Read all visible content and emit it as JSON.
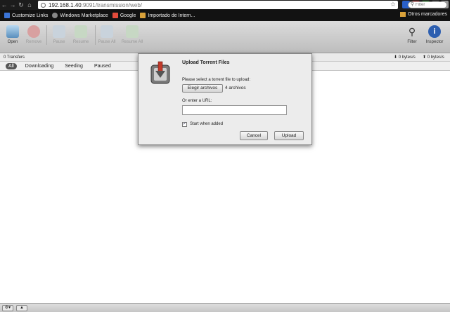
{
  "browser": {
    "url_host": "192.168.1.40",
    "url_rest": ":9091/transmission/web/",
    "bookmarks": [
      {
        "label": "Customize Links",
        "icon": "m-logo-icon"
      },
      {
        "label": "Windows Marketplace",
        "icon": "globe-icon"
      },
      {
        "label": "Google",
        "icon": "google-icon"
      },
      {
        "label": "Importado de Intern...",
        "icon": "folder-icon"
      }
    ],
    "other_bookmarks": "Otros marcadores"
  },
  "toolbar": {
    "open": "Open",
    "remove": "Remove",
    "pause": "Pause",
    "resume": "Resume",
    "pause_all": "Pause All",
    "resume_all": "Resume All",
    "filter": "Filter",
    "inspector": "Inspector"
  },
  "status": {
    "transfers": "0 Transfers",
    "down_speed": "0 bytes/s",
    "up_speed": "0 bytes/s"
  },
  "filters": {
    "tabs": [
      "All",
      "Downloading",
      "Seeding",
      "Paused"
    ],
    "active": "All",
    "search_placeholder": "Filter"
  },
  "dialog": {
    "title": "Upload Torrent Files",
    "select_label": "Please select a torrent file to upload:",
    "choose_button": "Elegir archivos",
    "choose_info": "4 archivos",
    "url_label": "Or enter a URL:",
    "url_value": "",
    "start_label": "Start when added",
    "start_checked": true,
    "cancel": "Cancel",
    "upload": "Upload"
  },
  "colors": {
    "chrome_dark": "#1c1c1c",
    "toolbar_bg": "#c8c8c8",
    "dialog_bg": "#ececec"
  }
}
